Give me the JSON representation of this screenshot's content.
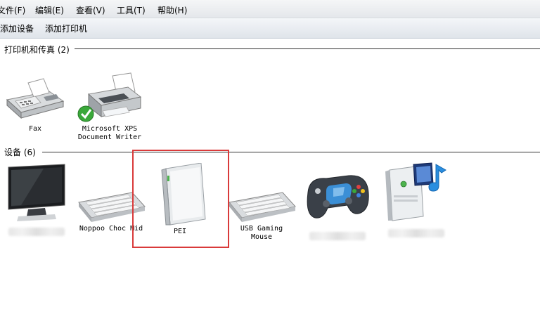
{
  "menubar": {
    "items": [
      "文件(F)",
      "编辑(E)",
      "查看(V)",
      "工具(T)",
      "帮助(H)"
    ]
  },
  "toolbar": {
    "add_device": "添加设备",
    "add_printer": "添加打印机"
  },
  "groups": {
    "printers": {
      "header": "打印机和传真 (2)"
    },
    "devices": {
      "header": "设备 (6)"
    }
  },
  "printers": [
    {
      "label": "Fax",
      "icon": "fax-icon"
    },
    {
      "label": "Microsoft XPS\nDocument Writer",
      "icon": "printer-default-icon"
    }
  ],
  "devices": [
    {
      "label": "",
      "icon": "monitor-icon"
    },
    {
      "label": "Noppoo Choc Mid",
      "icon": "keyboard-icon"
    },
    {
      "label": "PEI",
      "icon": "external-drive-icon"
    },
    {
      "label": "USB Gaming\nMouse",
      "icon": "keyboard-icon"
    },
    {
      "label": "",
      "icon": "gamepad-icon"
    },
    {
      "label": "",
      "icon": "media-device-icon"
    }
  ],
  "colors": {
    "highlight": "#d93a3a",
    "check_green": "#3aa83a",
    "gamepad_blue": "#3b8fd6"
  }
}
